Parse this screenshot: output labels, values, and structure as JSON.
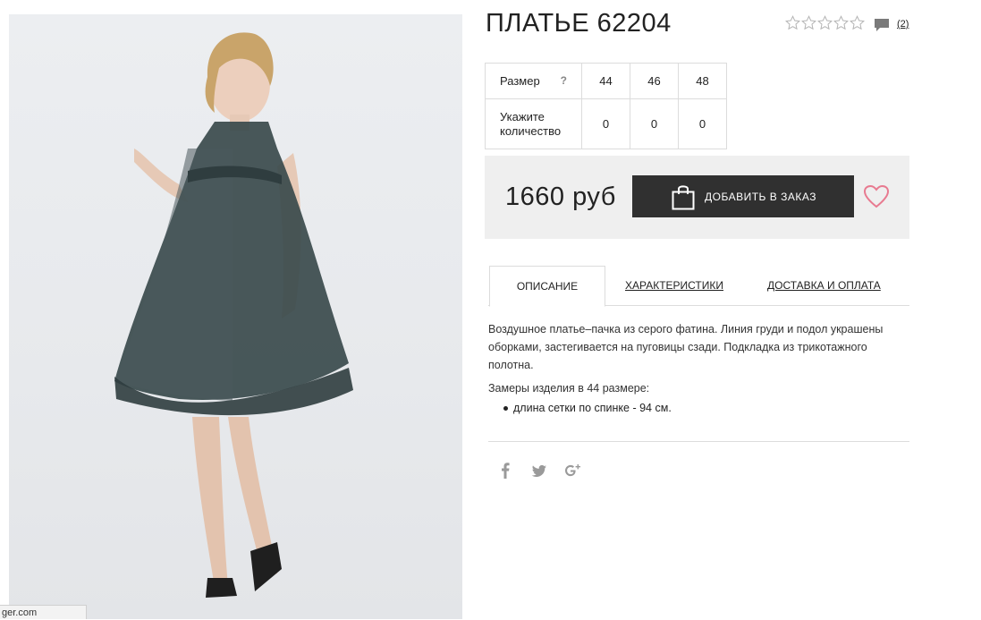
{
  "product": {
    "title": "ПЛАТЬЕ 62204",
    "reviews_count": "(2)",
    "price": "1660 руб"
  },
  "sizes_table": {
    "size_label": "Размер",
    "help_mark": "?",
    "sizes": [
      "44",
      "46",
      "48"
    ],
    "qty_label": "Укажите количество",
    "quantities": [
      "0",
      "0",
      "0"
    ]
  },
  "buy": {
    "add_to_order_label": "ДОБАВИТЬ В ЗАКАЗ"
  },
  "tabs": [
    {
      "label": "ОПИСАНИЕ"
    },
    {
      "label": "ХАРАКТЕРИСТИКИ"
    },
    {
      "label": "ДОСТАВКА И ОПЛАТА"
    }
  ],
  "description": {
    "text": "Воздушное платье–пачка из серого фатина. Линия груди и подол украшены оборками, застегивается на пуговицы сзади. Подкладка из трикотажного полотна.",
    "measures_title": "Замеры изделия в 44 размере:",
    "measures": [
      "длина сетки по спинке - 94 см."
    ]
  },
  "status_bar": {
    "url_fragment": "ger.com"
  },
  "icons": {
    "rating": "star-outline-icon",
    "reviews": "comment-icon",
    "bag": "shopping-bag-icon",
    "wishlist": "heart-icon",
    "social": [
      "facebook-icon",
      "twitter-icon",
      "google-plus-icon"
    ]
  },
  "colors": {
    "button_bg": "#303030",
    "buybox_bg": "#efefef",
    "heart": "#e87a90",
    "star_outline": "#b5b5b5",
    "social": "#9a9a9a"
  }
}
